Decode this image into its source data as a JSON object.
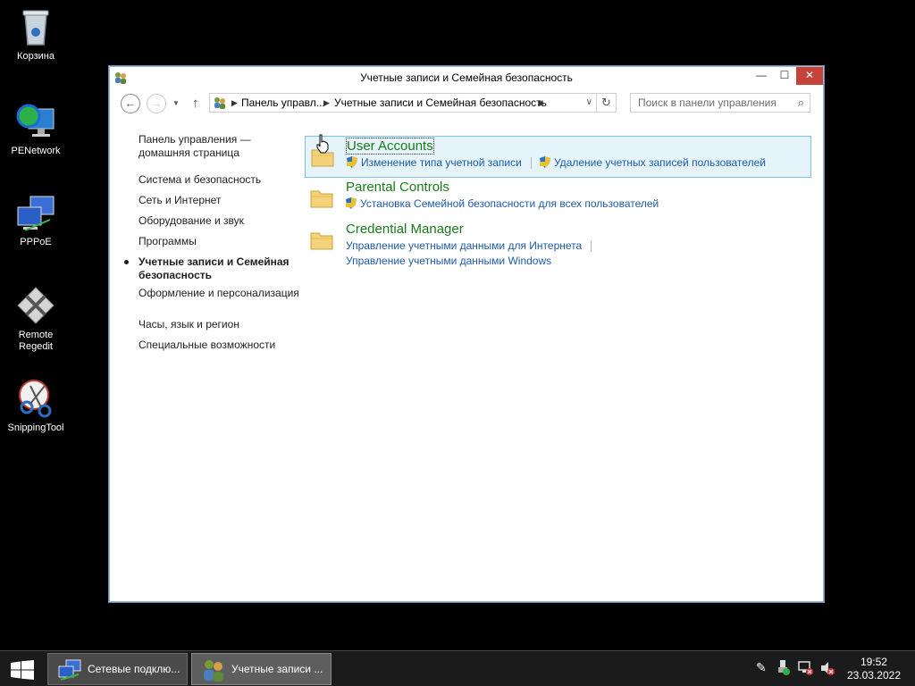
{
  "desktop": {
    "icons": [
      {
        "label": "Корзина",
        "icon": "recycle-bin-icon"
      },
      {
        "label": "PENetwork",
        "icon": "network-globe-icon"
      },
      {
        "label": "PPPoE",
        "icon": "network-computers-icon"
      },
      {
        "label": "Remote Regedit",
        "icon": "regedit-icon"
      },
      {
        "label": "SnippingTool",
        "icon": "scissors-icon"
      }
    ]
  },
  "window": {
    "title": "Учетные записи и Семейная безопасность",
    "controls": {
      "minimize": "—",
      "maximize": "☐",
      "close": "✕"
    },
    "address": {
      "segments": [
        "Панель управл...",
        "Учетные записи и Семейная безопасность"
      ]
    },
    "search": {
      "placeholder": "Поиск в панели управления"
    },
    "leftnav": {
      "items": [
        {
          "label": "Панель управления — домашняя страница"
        },
        {
          "label": "Система и безопасность"
        },
        {
          "label": "Сеть и Интернет"
        },
        {
          "label": "Оборудование и звук"
        },
        {
          "label": "Программы"
        },
        {
          "label": "Учетные записи и Семейная безопасность",
          "current": true
        },
        {
          "label": "Оформление и персонализация"
        },
        {
          "label": "Часы, язык и регион"
        },
        {
          "label": "Специальные возможности"
        }
      ]
    },
    "categories": [
      {
        "title": "User Accounts",
        "links": [
          "Изменение типа учетной записи",
          "Удаление учетных записей пользователей"
        ]
      },
      {
        "title": "Parental Controls",
        "links": [
          "Установка Семейной безопасности для всех пользователей"
        ]
      },
      {
        "title": "Credential Manager",
        "links": [
          "Управление учетными данными для Интернета",
          "Управление учетными данными Windows"
        ]
      }
    ]
  },
  "taskbar": {
    "buttons": [
      {
        "label": "Сетевые подклю..."
      },
      {
        "label": "Учетные записи ..."
      }
    ],
    "clock": {
      "time": "19:52",
      "date": "23.03.2022"
    }
  },
  "colors": {
    "category_title": "#1a7a1a",
    "link": "#1d5aa8",
    "selected_bg": "#e5f3fb",
    "close_button": "#c7433a"
  }
}
